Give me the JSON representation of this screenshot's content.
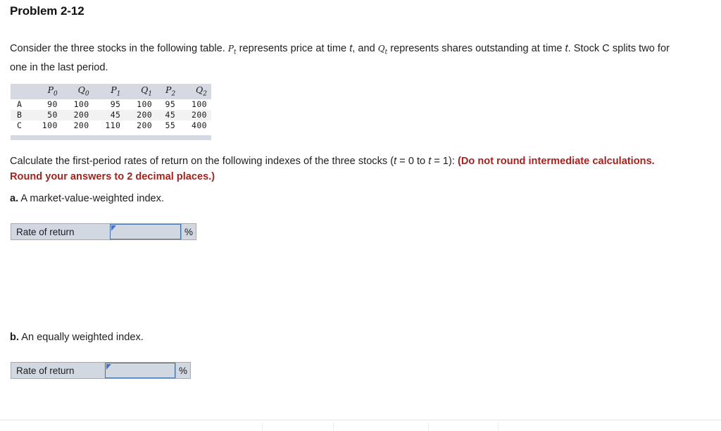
{
  "page": {
    "title": "Problem 2-12"
  },
  "intro": {
    "part1": "Consider the three stocks in the following table. ",
    "var_p": "P",
    "var_p_sub": "t",
    "part2": " represents price at time ",
    "var_t1": "t",
    "part3": ", and ",
    "var_q": "Q",
    "var_q_sub": "t",
    "part4": " represents shares outstanding at time ",
    "var_t2": "t",
    "part5": ". Stock C splits two for one in the last period."
  },
  "table": {
    "corner_header": "",
    "headers": [
      {
        "symbol": "P",
        "sub": "0"
      },
      {
        "symbol": "Q",
        "sub": "0"
      },
      {
        "symbol": "P",
        "sub": "1"
      },
      {
        "symbol": "Q",
        "sub": "1"
      },
      {
        "symbol": "P",
        "sub": "2"
      },
      {
        "symbol": "Q",
        "sub": "2"
      }
    ],
    "rows": [
      {
        "label": "A",
        "values": [
          "90",
          "100",
          "95",
          "100",
          "95",
          "100"
        ]
      },
      {
        "label": "B",
        "values": [
          "50",
          "200",
          "45",
          "200",
          "45",
          "200"
        ]
      },
      {
        "label": "C",
        "values": [
          "100",
          "200",
          "110",
          "200",
          "55",
          "400"
        ]
      }
    ]
  },
  "instruction": {
    "part1": "Calculate the first-period rates of return on the following indexes of the three stocks (",
    "t_var1": "t",
    "part2": " = 0 to ",
    "t_var2": "t",
    "part3": " = 1): ",
    "red_text": "(Do not round intermediate calculations. Round your answers to 2 decimal places.)"
  },
  "questions": [
    {
      "marker": "a.",
      "text": " A market-value-weighted index.",
      "answer": {
        "label": "Rate of return",
        "value": "",
        "placeholder": "",
        "unit": "%"
      }
    },
    {
      "marker": "b.",
      "text": " An equally weighted index.",
      "answer": {
        "label": "Rate of return",
        "value": "",
        "placeholder": "",
        "unit": "%"
      }
    }
  ],
  "colors": {
    "red_emphasis": "#a3231f",
    "table_header_bg": "#d5dae2",
    "widget_bg": "#d2d8e2",
    "input_border": "#4472a8",
    "flag_marker": "#4472c4"
  },
  "bottom_toolbar": {
    "separator_positions": [
      372,
      473,
      608,
      707
    ]
  }
}
